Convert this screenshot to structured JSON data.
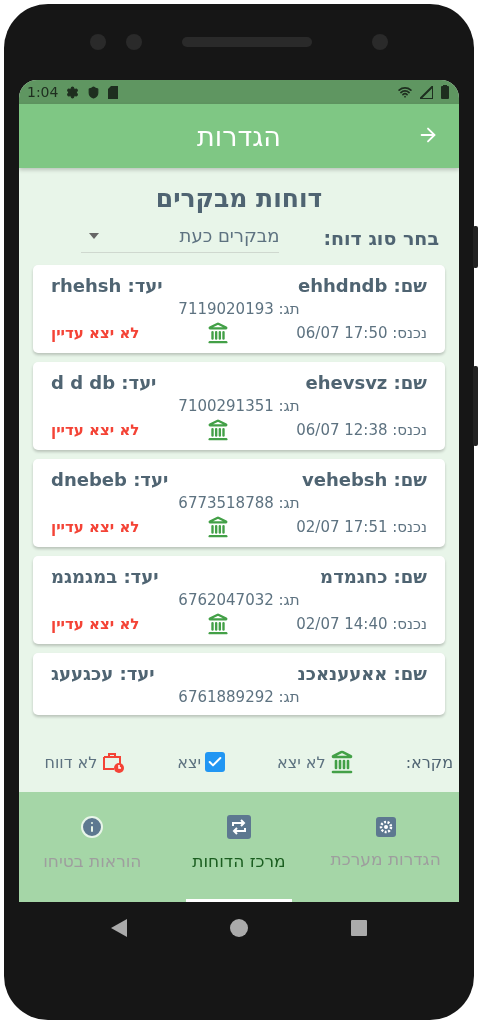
{
  "status_bar": {
    "time": "1:04"
  },
  "app_bar": {
    "title": "הגדרות"
  },
  "heading": "דוחות מבקרים",
  "report_type": {
    "label": "בחר סוג דוח:",
    "value": "מבקרים כעת"
  },
  "cards": [
    {
      "name": "שם: ehhdndb",
      "destination": "יעד: rhehsh",
      "tag": "תג: 7119020193",
      "entered_label": "נכנס:",
      "entered": "06/07 17:50",
      "status": "לא יצא עדיין"
    },
    {
      "name": "שם: ehevsvz",
      "destination": "יעד: d d db",
      "tag": "תג: 7100291351",
      "entered_label": "נכנס:",
      "entered": "06/07 12:38",
      "status": "לא יצא עדיין"
    },
    {
      "name": "שם: vehebsh",
      "destination": "יעד: dnebeb",
      "tag": "תג: 6773518788",
      "entered_label": "נכנס:",
      "entered": "02/07 17:51",
      "status": "לא יצא עדיין"
    },
    {
      "name": "שם: כחגמדמ",
      "destination": "יעד: במגמגמ",
      "tag": "תג: 6762047032",
      "entered_label": "נכנס:",
      "entered": "02/07 14:40",
      "status": "לא יצא עדיין"
    },
    {
      "name": "שם: אאעענאכנ",
      "destination": "יעד: עכגעעג",
      "tag": "תג: 6761889292"
    }
  ],
  "legend": {
    "title": "מקרא:",
    "items": [
      {
        "kind": "building",
        "label": "לא יצא"
      },
      {
        "kind": "checkbox",
        "label": "יצא"
      },
      {
        "kind": "briefcase",
        "label": "לא דווח"
      }
    ]
  },
  "bottom_nav": [
    {
      "kind": "settings",
      "label": "הגדרות מערכת",
      "selected": false
    },
    {
      "kind": "reports",
      "label": "מרכז הדוחות",
      "selected": true
    },
    {
      "kind": "info",
      "label": "הוראות בטיחו",
      "selected": false
    }
  ]
}
